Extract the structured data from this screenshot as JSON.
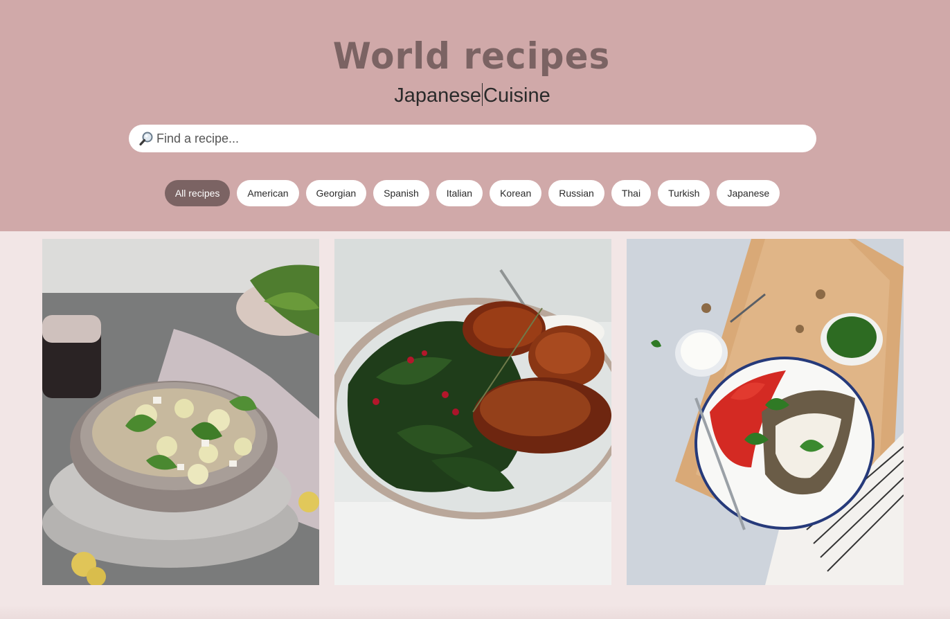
{
  "header": {
    "title": "World recipes",
    "subtitle_left": "Japanese",
    "subtitle_right": "Cuisine"
  },
  "search": {
    "placeholder": "Find a recipe...",
    "value": "",
    "icon": "magnifier-icon"
  },
  "filters": [
    {
      "label": "All recipes",
      "active": true
    },
    {
      "label": "American",
      "active": false
    },
    {
      "label": "Georgian",
      "active": false
    },
    {
      "label": "Spanish",
      "active": false
    },
    {
      "label": "Italian",
      "active": false
    },
    {
      "label": "Korean",
      "active": false
    },
    {
      "label": "Russian",
      "active": false
    },
    {
      "label": "Thai",
      "active": false
    },
    {
      "label": "Turkish",
      "active": false
    },
    {
      "label": "Japanese",
      "active": false
    }
  ],
  "recipes": [
    {
      "image": "melon-feta-salad-bowl-photo"
    },
    {
      "image": "roasted-chicken-with-kale-photo"
    },
    {
      "image": "stuffed-eggplant-tomato-salad-photo"
    }
  ],
  "colors": {
    "header_bg": "#d0a9a9",
    "page_bg": "#f2e6e6",
    "accent": "#7b6363",
    "chip_bg": "#ffffff"
  }
}
